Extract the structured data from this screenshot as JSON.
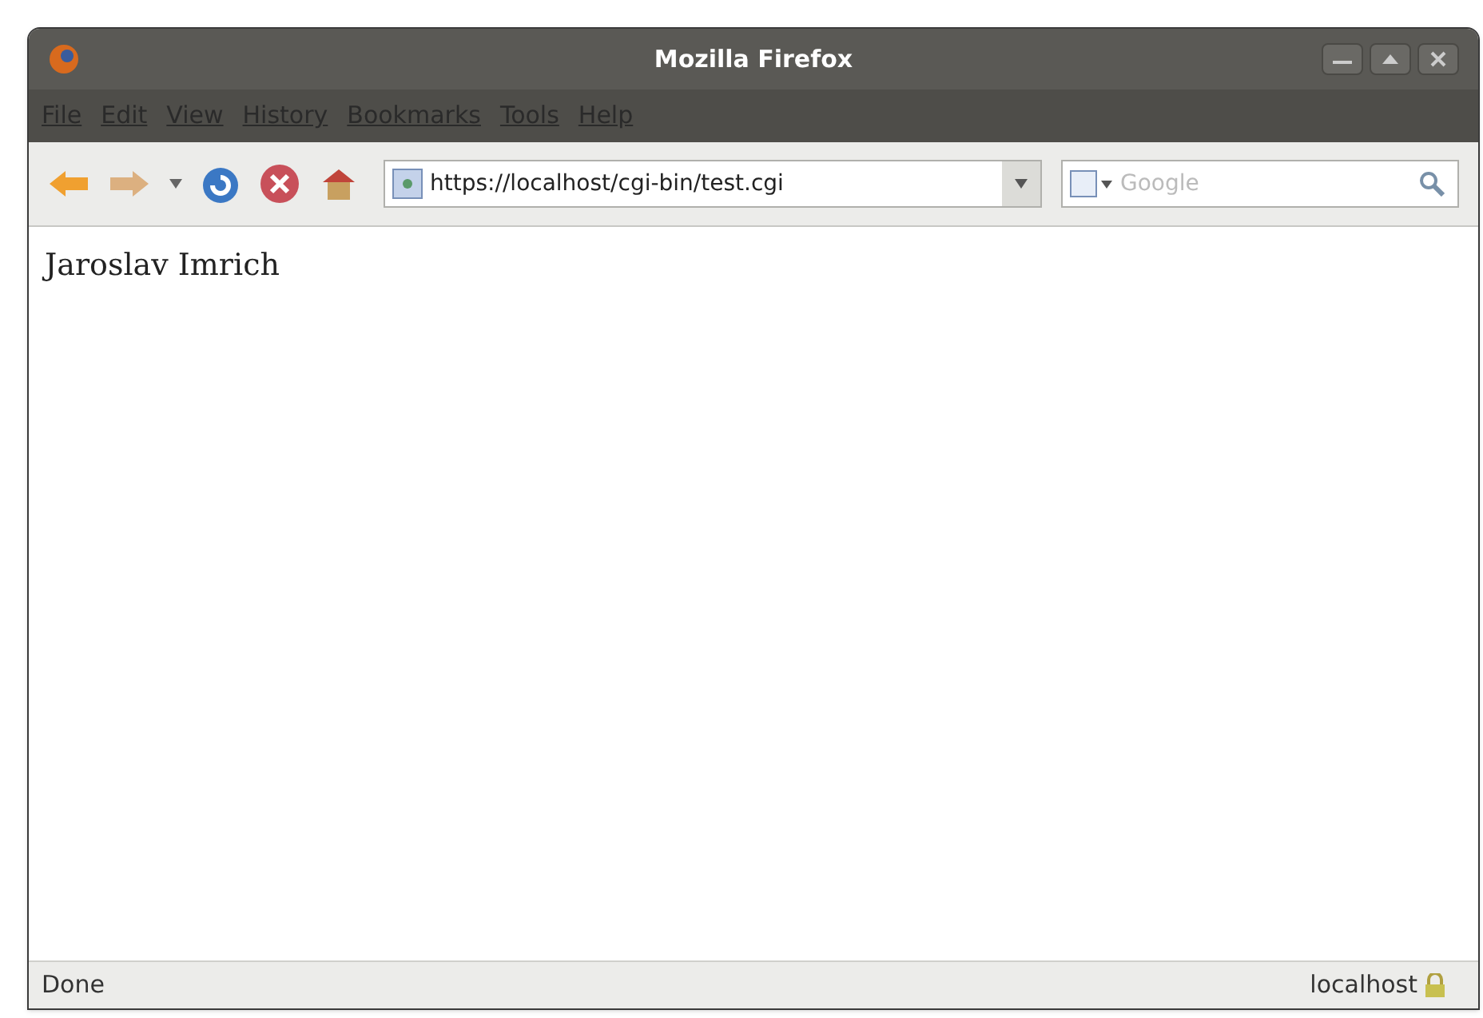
{
  "window": {
    "title": "Mozilla Firefox"
  },
  "menu": [
    "File",
    "Edit",
    "View",
    "History",
    "Bookmarks",
    "Tools",
    "Help"
  ],
  "address_bar": {
    "value": "https://localhost/cgi-bin/test.cgi"
  },
  "search": {
    "placeholder": "Google"
  },
  "page": {
    "text": "Jaroslav Imrich"
  },
  "status_bar": {
    "status": "Done",
    "host": "localhost"
  }
}
